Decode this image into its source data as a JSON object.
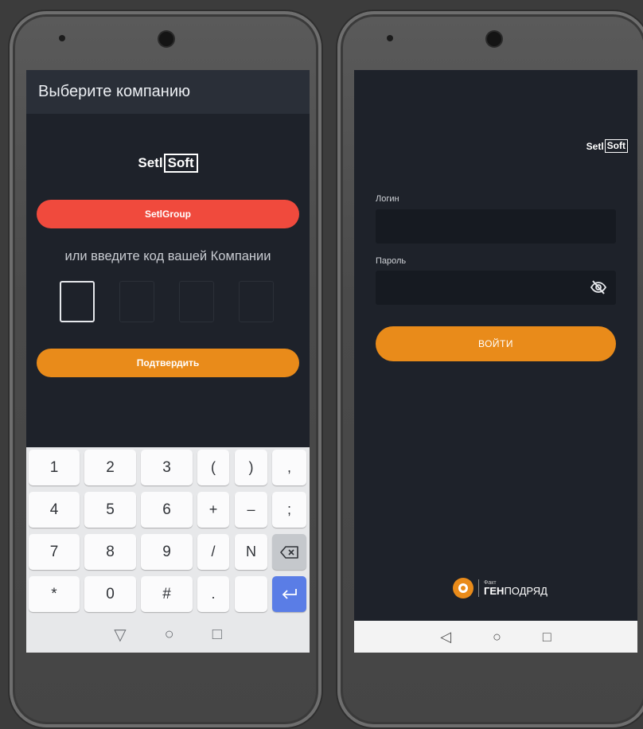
{
  "left": {
    "title": "Выберите компанию",
    "logo": {
      "part1": "Setl",
      "part2": "Soft"
    },
    "company_button": "SetlGroup",
    "or_text": "или введите код вашей Компании",
    "confirm_button": "Подтвердить",
    "keyboard": {
      "row1": [
        "1",
        "2",
        "3",
        "(",
        ")",
        ","
      ],
      "row2": [
        "4",
        "5",
        "6",
        "+",
        "–",
        ";"
      ],
      "row3": [
        "7",
        "8",
        "9",
        "/",
        "N",
        "⌫"
      ],
      "row4": [
        "*",
        "0",
        "#",
        ".",
        "",
        "⏎"
      ]
    },
    "nav": {
      "back": "▽",
      "home": "○",
      "recent": "□"
    }
  },
  "right": {
    "logo": {
      "part1": "Setl",
      "part2": "Soft"
    },
    "login_label": "Логин",
    "password_label": "Пароль",
    "login_button": "ВОЙТИ",
    "brand": {
      "small": "Факт",
      "bold": "ГЕН",
      "rest": "ПОДРЯД"
    },
    "nav": {
      "back": "◁",
      "home": "○",
      "recent": "□"
    }
  },
  "colors": {
    "accent_orange": "#e98b1a",
    "accent_red": "#f04a3d",
    "screen_bg": "#1e222a"
  }
}
